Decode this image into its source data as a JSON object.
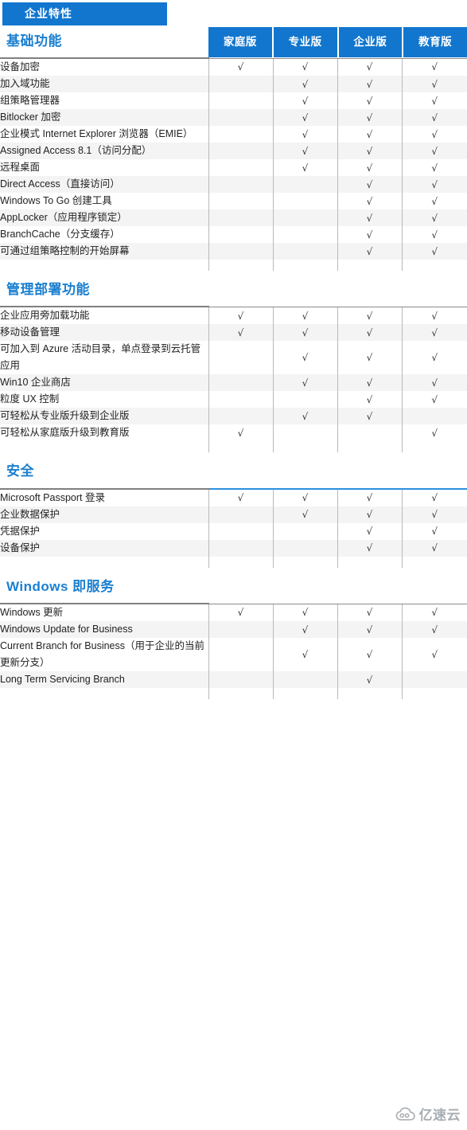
{
  "tab": {
    "label": "企业特性"
  },
  "columns": [
    "家庭版",
    "专业版",
    "企业版",
    "教育版"
  ],
  "check": "√",
  "watermark": {
    "text": "亿速云",
    "icon": "cloud-icon"
  },
  "sections": [
    {
      "title": "基础功能",
      "inline_header": true,
      "rows": [
        {
          "label": "设备加密",
          "marks": [
            true,
            true,
            true,
            true
          ]
        },
        {
          "label": "加入域功能",
          "marks": [
            false,
            true,
            true,
            true
          ]
        },
        {
          "label": "组策略管理器",
          "marks": [
            false,
            true,
            true,
            true
          ]
        },
        {
          "label": "Bitlocker 加密",
          "marks": [
            false,
            true,
            true,
            true
          ]
        },
        {
          "label": "企业模式 Internet Explorer 浏览器（EMIE）",
          "marks": [
            false,
            true,
            true,
            true
          ]
        },
        {
          "label": "Assigned Access 8.1（访问分配）",
          "marks": [
            false,
            true,
            true,
            true
          ]
        },
        {
          "label": "远程桌面",
          "marks": [
            false,
            true,
            true,
            true
          ]
        },
        {
          "label": "Direct Access（直接访问）",
          "marks": [
            false,
            false,
            true,
            true
          ]
        },
        {
          "label": "Windows To Go 创建工具",
          "marks": [
            false,
            false,
            true,
            true
          ]
        },
        {
          "label": "AppLocker（应用程序锁定）",
          "marks": [
            false,
            false,
            true,
            true
          ]
        },
        {
          "label": "BranchCache（分支缓存）",
          "marks": [
            false,
            false,
            true,
            true
          ]
        },
        {
          "label": "可通过组策略控制的开始屏幕",
          "marks": [
            false,
            false,
            true,
            true
          ]
        }
      ]
    },
    {
      "title": "管理部署功能",
      "inline_header": false,
      "rows": [
        {
          "label": "企业应用旁加载功能",
          "marks": [
            true,
            true,
            true,
            true
          ]
        },
        {
          "label": "移动设备管理",
          "marks": [
            true,
            true,
            true,
            true
          ]
        },
        {
          "label": "可加入到 Azure 活动目录，单点登录到云托管应用",
          "marks": [
            false,
            true,
            true,
            true
          ]
        },
        {
          "label": "Win10 企业商店",
          "marks": [
            false,
            true,
            true,
            true
          ]
        },
        {
          "label": "粒度 UX 控制",
          "marks": [
            false,
            false,
            true,
            true
          ]
        },
        {
          "label": "可轻松从专业版升级到企业版",
          "marks": [
            false,
            true,
            true,
            false
          ]
        },
        {
          "label": "可轻松从家庭版升级到教育版",
          "marks": [
            true,
            false,
            false,
            true
          ]
        }
      ]
    },
    {
      "title": "安全",
      "inline_header": false,
      "blue_top": true,
      "rows": [
        {
          "label": "Microsoft Passport 登录",
          "marks": [
            true,
            true,
            true,
            true
          ]
        },
        {
          "label": "企业数据保护",
          "marks": [
            false,
            true,
            true,
            true
          ]
        },
        {
          "label": "凭据保护",
          "marks": [
            false,
            false,
            true,
            true
          ]
        },
        {
          "label": "设备保护",
          "marks": [
            false,
            false,
            true,
            true
          ]
        }
      ]
    },
    {
      "title": "Windows 即服务",
      "inline_header": false,
      "rows": [
        {
          "label": "Windows 更新",
          "marks": [
            true,
            true,
            true,
            true
          ]
        },
        {
          "label": "Windows Update for Business",
          "marks": [
            false,
            true,
            true,
            true
          ]
        },
        {
          "label": "Current Branch for Business（用于企业的当前更新分支）",
          "marks": [
            false,
            true,
            true,
            true
          ]
        },
        {
          "label": "Long Term Servicing Branch",
          "marks": [
            false,
            false,
            true,
            false
          ]
        }
      ]
    }
  ]
}
